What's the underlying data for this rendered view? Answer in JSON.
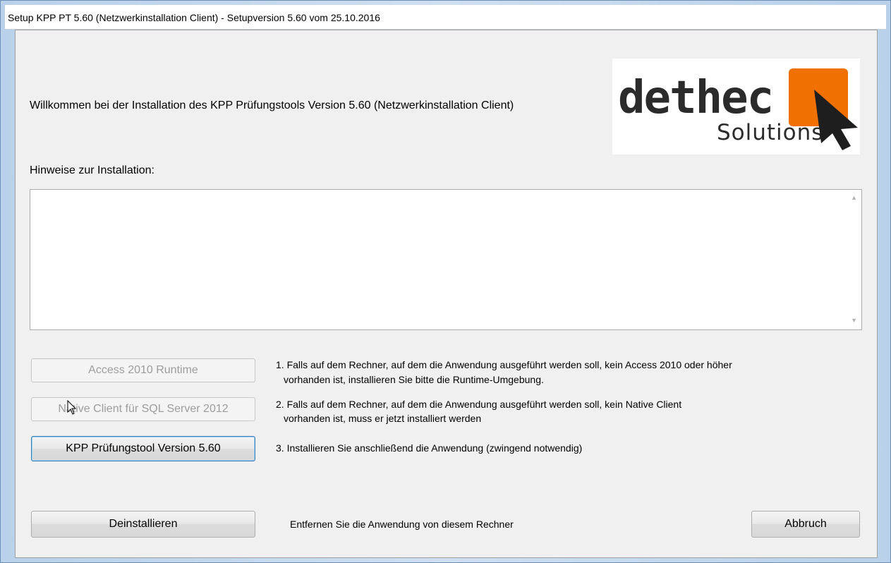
{
  "window": {
    "title": "Setup KPP PT 5.60 (Netzwerkinstallation Client) - Setupversion 5.60 vom 25.10.2016"
  },
  "welcome_text": "Willkommen bei der Installation des KPP Prüfungstools Version 5.60 (Netzwerkinstallation Client)",
  "logo": {
    "name": "dethec",
    "tagline": "Solutions",
    "accent_color": "#f07000"
  },
  "hints": {
    "label": "Hinweise zur Installation:",
    "content": ""
  },
  "steps": [
    {
      "button_label": "Access 2010 Runtime",
      "enabled": false,
      "description_line1": "1. Falls auf dem Rechner, auf dem die Anwendung ausgeführt werden soll, kein Access 2010 oder höher",
      "description_line2": "vorhanden ist, installieren Sie bitte die Runtime-Umgebung."
    },
    {
      "button_label": "Native Client für SQL Server 2012",
      "enabled": false,
      "description_line1": "2. Falls auf dem Rechner, auf dem die Anwendung ausgeführt werden soll, kein Native Client",
      "description_line2": "vorhanden ist, muss er jetzt installiert werden"
    },
    {
      "button_label": "KPP Prüfungstool Version 5.60",
      "enabled": true,
      "description_line1": "3. Installieren Sie anschließend die Anwendung (zwingend notwendig)"
    }
  ],
  "uninstall": {
    "button_label": "Deinstallieren",
    "description": "Entfernen Sie die Anwendung von diesem Rechner"
  },
  "cancel": {
    "button_label": "Abbruch"
  }
}
